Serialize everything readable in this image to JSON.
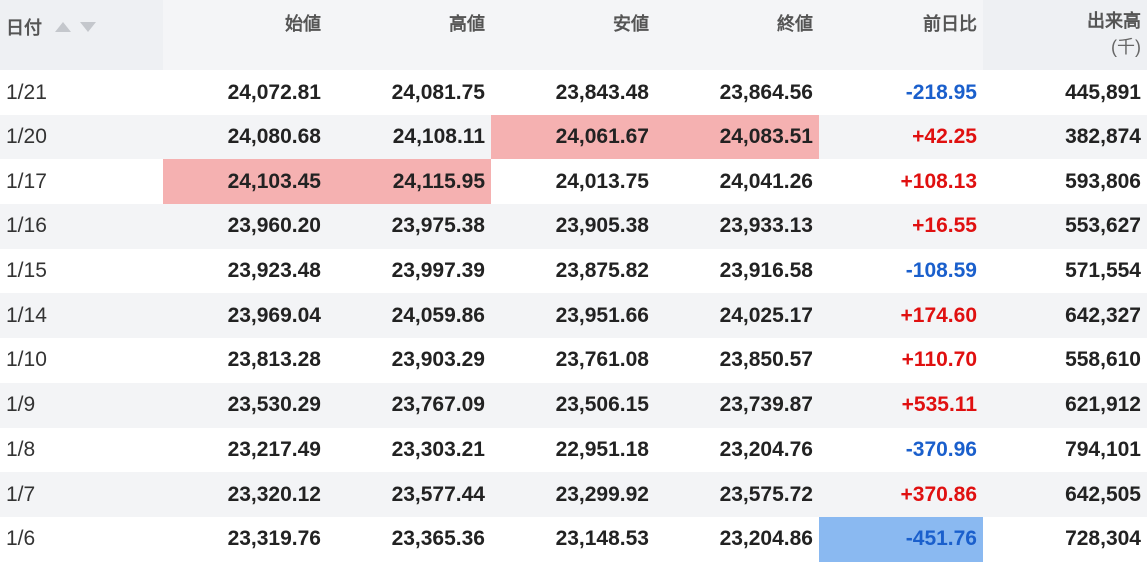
{
  "table": {
    "headers": {
      "date": "日付",
      "open": "始値",
      "high": "高値",
      "low": "安値",
      "close": "終値",
      "change": "前日比",
      "volume": "出来高",
      "volume_unit": "(千)"
    },
    "rows": [
      {
        "date": "1/21",
        "open": "24,072.81",
        "high": "24,081.75",
        "low": "23,843.48",
        "close": "23,864.56",
        "change": "-218.95",
        "volume": "445,891"
      },
      {
        "date": "1/20",
        "open": "24,080.68",
        "high": "24,108.11",
        "low": "24,061.67",
        "close": "24,083.51",
        "change": "+42.25",
        "volume": "382,874"
      },
      {
        "date": "1/17",
        "open": "24,103.45",
        "high": "24,115.95",
        "low": "24,013.75",
        "close": "24,041.26",
        "change": "+108.13",
        "volume": "593,806"
      },
      {
        "date": "1/16",
        "open": "23,960.20",
        "high": "23,975.38",
        "low": "23,905.38",
        "close": "23,933.13",
        "change": "+16.55",
        "volume": "553,627"
      },
      {
        "date": "1/15",
        "open": "23,923.48",
        "high": "23,997.39",
        "low": "23,875.82",
        "close": "23,916.58",
        "change": "-108.59",
        "volume": "571,554"
      },
      {
        "date": "1/14",
        "open": "23,969.04",
        "high": "24,059.86",
        "low": "23,951.66",
        "close": "24,025.17",
        "change": "+174.60",
        "volume": "642,327"
      },
      {
        "date": "1/10",
        "open": "23,813.28",
        "high": "23,903.29",
        "low": "23,761.08",
        "close": "23,850.57",
        "change": "+110.70",
        "volume": "558,610"
      },
      {
        "date": "1/9",
        "open": "23,530.29",
        "high": "23,767.09",
        "low": "23,506.15",
        "close": "23,739.87",
        "change": "+535.11",
        "volume": "621,912"
      },
      {
        "date": "1/8",
        "open": "23,217.49",
        "high": "23,303.21",
        "low": "22,951.18",
        "close": "23,204.76",
        "change": "-370.96",
        "volume": "794,101"
      },
      {
        "date": "1/7",
        "open": "23,320.12",
        "high": "23,577.44",
        "low": "23,299.92",
        "close": "23,575.72",
        "change": "+370.86",
        "volume": "642,505"
      },
      {
        "date": "1/6",
        "open": "23,319.76",
        "high": "23,365.36",
        "low": "23,148.53",
        "close": "23,204.86",
        "change": "-451.76",
        "volume": "728,304"
      }
    ]
  },
  "colors": {
    "positive": "#e01010",
    "negative": "#1a5fcc",
    "highlight_red": "#f5b1b1",
    "highlight_blue": "#8ab9f1"
  },
  "icons": {
    "sort_asc": "sort-asc-icon",
    "sort_desc": "sort-desc-icon"
  }
}
